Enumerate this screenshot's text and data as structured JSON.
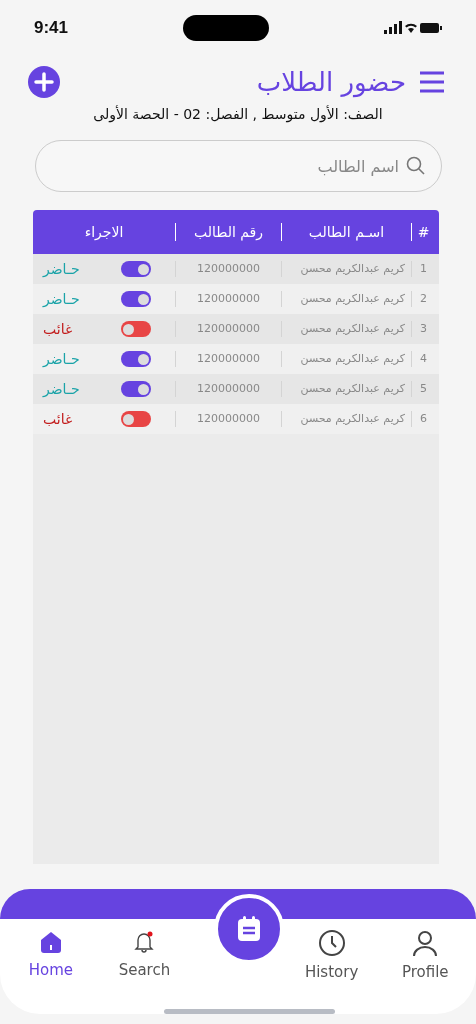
{
  "status_bar": {
    "time": "9:41"
  },
  "header": {
    "title": "حضور الطلاب",
    "subtitle": "الصف: الأول متوسط , الفصل: 02 - الحصة الأولى"
  },
  "search": {
    "placeholder": "اسم الطالب"
  },
  "table": {
    "columns": [
      "#",
      "اسـم الطالب",
      "رقم الطالب",
      "الاجراء"
    ],
    "rows": [
      {
        "index": "1",
        "name": "كريم عبدالكريم محسن",
        "number": "120000000",
        "present": true,
        "status": "حـاضر"
      },
      {
        "index": "2",
        "name": "كريم عبدالكريم محسن",
        "number": "120000000",
        "present": true,
        "status": "حـاضر"
      },
      {
        "index": "3",
        "name": "كريم عبدالكريم محسن",
        "number": "120000000",
        "present": false,
        "status": "غائب"
      },
      {
        "index": "4",
        "name": "كريم عبدالكريم محسن",
        "number": "120000000",
        "present": true,
        "status": "حـاضر"
      },
      {
        "index": "5",
        "name": "كريم عبدالكريم محسن",
        "number": "120000000",
        "present": true,
        "status": "حـاضر"
      },
      {
        "index": "6",
        "name": "كريم عبدالكريم محسن",
        "number": "120000000",
        "present": false,
        "status": "غائب"
      }
    ]
  },
  "nav": {
    "items": [
      {
        "kind": "user",
        "label": "Profile",
        "selected": false
      },
      {
        "kind": "clock",
        "label": "History",
        "selected": false
      },
      {
        "kind": "center"
      },
      {
        "kind": "bell",
        "label": "Search",
        "selected": false,
        "badge": true
      },
      {
        "kind": "home",
        "label": "Home",
        "selected": true
      }
    ]
  }
}
